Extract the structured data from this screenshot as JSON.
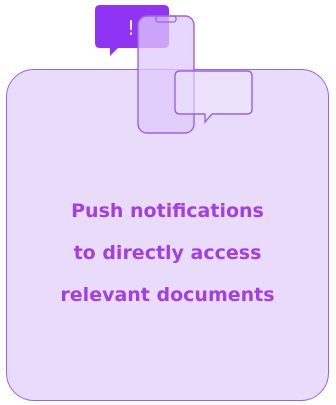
{
  "card": {
    "lines": [
      "Push notifications",
      "to directly access",
      "relevant documents"
    ]
  },
  "illustration": {
    "icons": [
      "alert-bubble-icon",
      "phone-icon",
      "chat-bubble-icon"
    ],
    "alert_glyph": "!",
    "colors": {
      "card_fill": "#e9dcfb",
      "card_border": "#9a63e6",
      "accent": "#8f34f5",
      "phone_fill": "#dfc9fb",
      "text": "#a33ee6"
    }
  }
}
